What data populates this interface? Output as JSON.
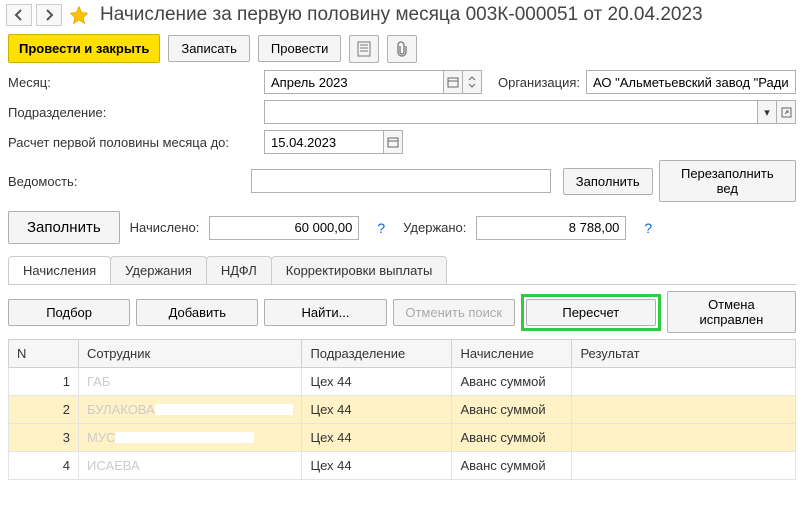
{
  "header": {
    "title": "Начисление за первую половину месяца 003К-000051 от 20.04.2023"
  },
  "toolbar": {
    "post_close": "Провести и закрыть",
    "save": "Записать",
    "post": "Провести"
  },
  "form": {
    "month_label": "Месяц:",
    "month_value": "Апрель 2023",
    "org_label": "Организация:",
    "org_value": "АО \"Альметьевский завод \"Радиоприбор\"",
    "dept_label": "Подразделение:",
    "dept_value": "",
    "calc_to_label": "Расчет первой половины месяца до:",
    "calc_to_value": "15.04.2023",
    "statement_label": "Ведомость:",
    "statement_value": "",
    "fill_btn": "Заполнить",
    "refill_btn": "Перезаполнить вед",
    "accrued_label": "Начислено:",
    "accrued_value": "60 000,00",
    "withheld_label": "Удержано:",
    "withheld_value": "8 788,00"
  },
  "tabs": {
    "items": [
      "Начисления",
      "Удержания",
      "НДФЛ",
      "Корректировки выплаты"
    ]
  },
  "tab_toolbar": {
    "pick": "Подбор",
    "add": "Добавить",
    "find": "Найти...",
    "cancel_search": "Отменить поиск",
    "recalc": "Пересчет",
    "cancel_fix": "Отмена исправлен"
  },
  "table": {
    "headers": {
      "n": "N",
      "employee": "Сотрудник",
      "dept": "Подразделение",
      "accrual": "Начисление",
      "result": "Результат"
    },
    "rows": [
      {
        "n": "1",
        "employee_visible": "ГАБ",
        "dept": "Цех 44",
        "accrual": "Аванс суммой"
      },
      {
        "n": "2",
        "employee_visible": "БУЛАКОВА",
        "dept": "Цех 44",
        "accrual": "Аванс суммой"
      },
      {
        "n": "3",
        "employee_visible": "МУС",
        "dept": "Цех 44",
        "accrual": "Аванс суммой"
      },
      {
        "n": "4",
        "employee_visible": "ИСАЕВА",
        "dept": "Цех 44",
        "accrual": "Аванс суммой"
      }
    ]
  }
}
